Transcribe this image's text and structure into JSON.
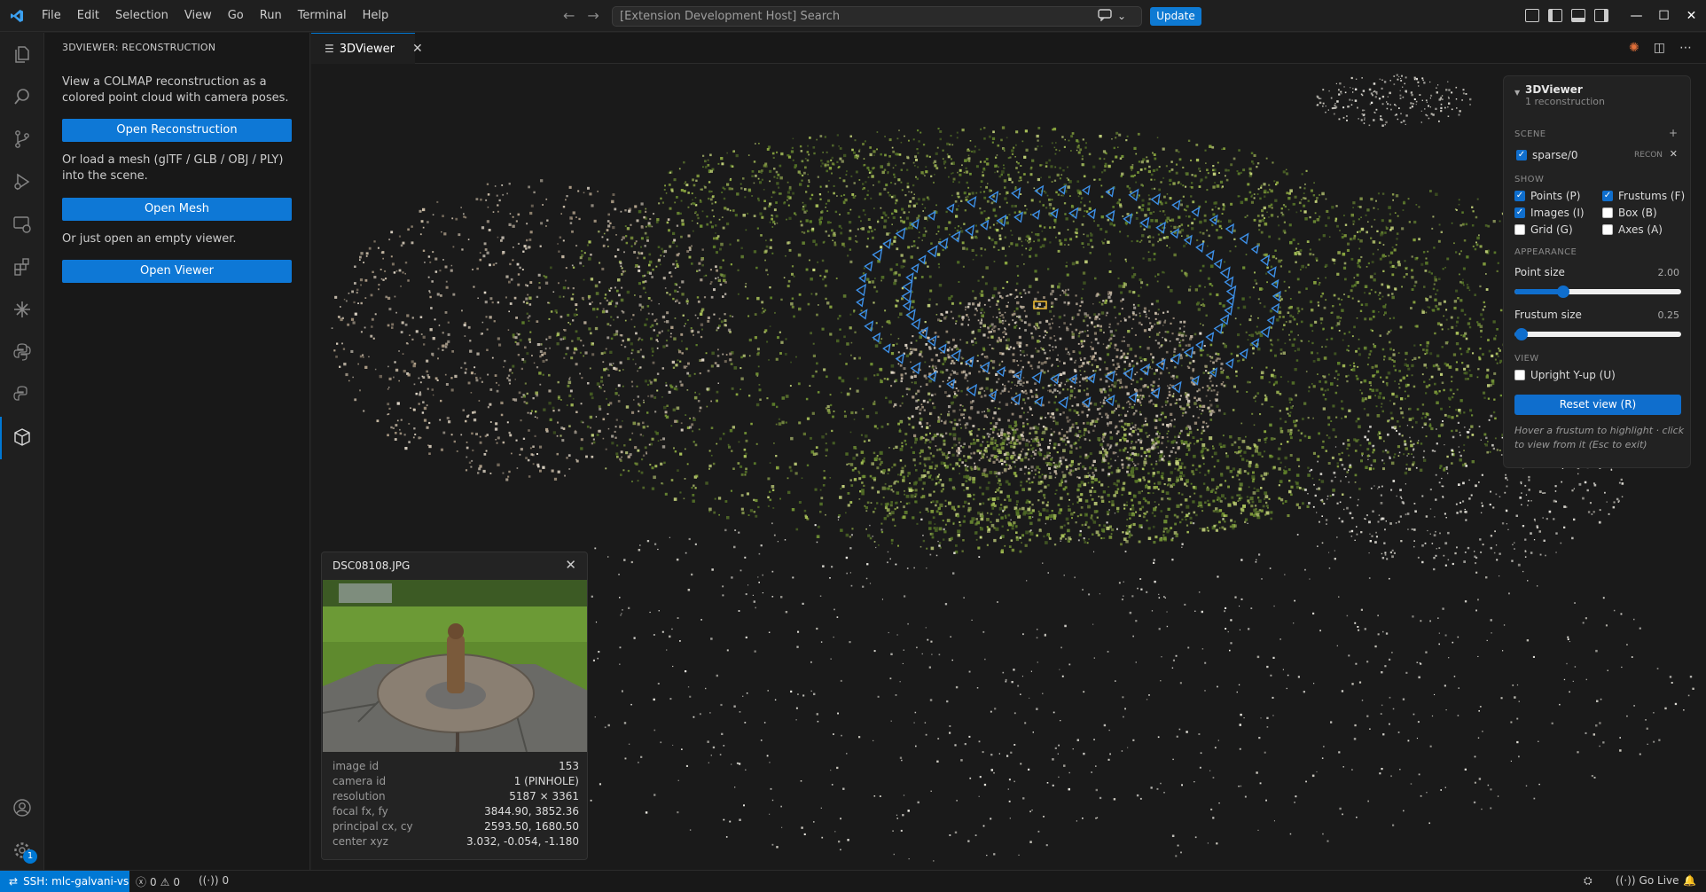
{
  "titlebar": {
    "menus": [
      "File",
      "Edit",
      "Selection",
      "View",
      "Go",
      "Run",
      "Terminal",
      "Help"
    ],
    "search_placeholder": "[Extension Development Host] Search",
    "update_label": "Update",
    "accent": "#0078d4"
  },
  "sidebar": {
    "title": "3DVIEWER: RECONSTRUCTION",
    "intro": "View a COLMAP reconstruction as a colored point cloud with camera poses.",
    "open_reconstruction": "Open Reconstruction",
    "mesh_text": "Or load a mesh (glTF / GLB / OBJ / PLY) into the scene.",
    "open_mesh": "Open Mesh",
    "viewer_text": "Or just open an empty viewer.",
    "open_viewer": "Open Viewer"
  },
  "editor": {
    "tab_label": "3DViewer"
  },
  "panel": {
    "title": "3DViewer",
    "subtitle": "1 reconstruction",
    "scene_label": "SCENE",
    "scene_add": "+",
    "scene_item": "sparse/0",
    "scene_tag": "RECON",
    "show_label": "SHOW",
    "show": {
      "points": {
        "label": "Points (P)",
        "checked": true
      },
      "frustums": {
        "label": "Frustums (F)",
        "checked": true
      },
      "images": {
        "label": "Images (I)",
        "checked": true
      },
      "box": {
        "label": "Box (B)",
        "checked": false
      },
      "grid": {
        "label": "Grid (G)",
        "checked": false
      },
      "axes": {
        "label": "Axes (A)",
        "checked": false
      }
    },
    "appearance_label": "APPEARANCE",
    "point_size_label": "Point size",
    "point_size_value": "2.00",
    "point_size_fraction": 0.29,
    "frustum_size_label": "Frustum size",
    "frustum_size_value": "0.25",
    "frustum_size_fraction": 0.04,
    "view_label": "VIEW",
    "upright_label": "Upright Y-up (U)",
    "upright_checked": false,
    "reset_label": "Reset view (R)",
    "hint": "Hover a frustum to highlight · click to view from it (Esc to exit)"
  },
  "popup": {
    "filename": "DSC08108.JPG",
    "rows": [
      {
        "key": "image id",
        "value": "153"
      },
      {
        "key": "camera id",
        "value": "1 (PINHOLE)"
      },
      {
        "key": "resolution",
        "value": "5187 × 3361"
      },
      {
        "key": "focal fx, fy",
        "value": "3844.90, 3852.36"
      },
      {
        "key": "principal cx, cy",
        "value": "2593.50, 1680.50"
      },
      {
        "key": "center xyz",
        "value": "3.032, -0.054, -1.180"
      }
    ]
  },
  "statusbar": {
    "remote": "SSH: mlc-galvani-vs",
    "errors": "0",
    "warnings": "0",
    "ports": "0",
    "go_live": "Go Live"
  },
  "activity_badge": "1"
}
